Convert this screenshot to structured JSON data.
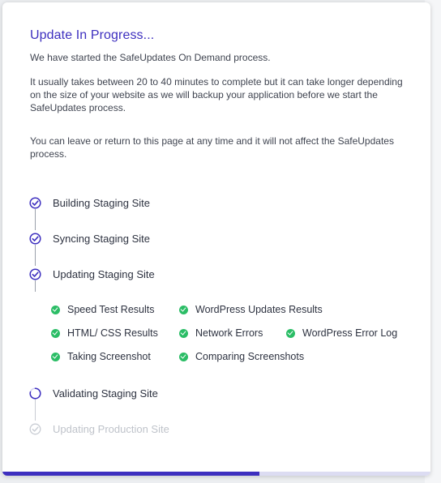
{
  "modal": {
    "title": "Update In Progress...",
    "intro": "We have started the SafeUpdates On Demand process.",
    "duration_note": "It usually takes between 20 to 40 minutes to complete but it can take longer depending on the size of your website as we will backup your application before we start the SafeUpdates process.",
    "leave_note": "You can leave or return to this page at any time and it will not affect the SafeUpdates process."
  },
  "steps": [
    {
      "label": "Building Staging Site",
      "status": "done"
    },
    {
      "label": "Syncing Staging Site",
      "status": "done"
    },
    {
      "label": "Updating Staging Site",
      "status": "done"
    },
    {
      "label": "Validating Staging Site",
      "status": "in-progress"
    },
    {
      "label": "Updating Production Site",
      "status": "pending"
    }
  ],
  "substeps": [
    {
      "label": "Speed Test Results",
      "status": "done"
    },
    {
      "label": "WordPress Updates Results",
      "status": "done"
    },
    {
      "label": "HTML/ CSS Results",
      "status": "done"
    },
    {
      "label": "Network Errors",
      "status": "done"
    },
    {
      "label": "WordPress Error Log",
      "status": "done"
    },
    {
      "label": "Taking Screenshot",
      "status": "done"
    },
    {
      "label": "Comparing Screenshots",
      "status": "done"
    }
  ],
  "progress": {
    "percent": 60
  },
  "colors": {
    "accent": "#3d2fbf",
    "success": "#2bbd66",
    "muted": "#bfc3ca"
  }
}
